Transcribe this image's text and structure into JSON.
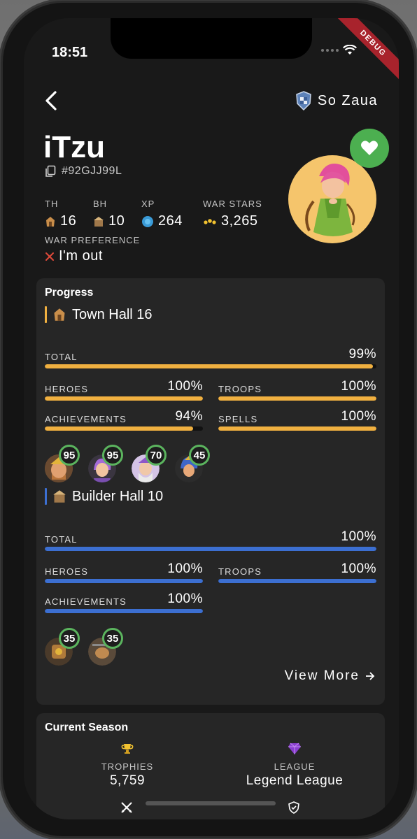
{
  "status": {
    "time": "18:51",
    "debug_label": "DEBUG"
  },
  "header": {
    "clan_name": "So Zaua"
  },
  "player": {
    "name": "iTzu",
    "tag": "#92GJJ99L",
    "stats": [
      {
        "label": "TH",
        "value": "16"
      },
      {
        "label": "BH",
        "value": "10"
      },
      {
        "label": "XP",
        "value": "264"
      },
      {
        "label": "WAR STARS",
        "value": "3,265"
      }
    ],
    "war_preference": {
      "label": "WAR PREFERENCE",
      "value": "I'm out"
    }
  },
  "progress": {
    "title": "Progress",
    "home": {
      "title": "Town Hall 16",
      "accent": "#f0b040",
      "total": {
        "label": "TOTAL",
        "pct": "99%",
        "value": 0.99
      },
      "items": [
        {
          "label": "HEROES",
          "pct": "100%",
          "value": 1.0
        },
        {
          "label": "TROOPS",
          "pct": "100%",
          "value": 1.0
        },
        {
          "label": "ACHIEVEMENTS",
          "pct": "94%",
          "value": 0.94
        },
        {
          "label": "SPELLS",
          "pct": "100%",
          "value": 1.0
        }
      ],
      "heroes": [
        "95",
        "95",
        "70",
        "45"
      ]
    },
    "builder": {
      "title": "Builder Hall 10",
      "accent": "#3c6fd1",
      "total": {
        "label": "TOTAL",
        "pct": "100%",
        "value": 1.0
      },
      "items": [
        {
          "label": "HEROES",
          "pct": "100%",
          "value": 1.0
        },
        {
          "label": "TROOPS",
          "pct": "100%",
          "value": 1.0
        },
        {
          "label": "ACHIEVEMENTS",
          "pct": "100%",
          "value": 1.0
        }
      ],
      "heroes": [
        "35",
        "35"
      ]
    },
    "view_more": "View More"
  },
  "season": {
    "title": "Current Season",
    "trophies": {
      "label": "TROPHIES",
      "value": "5,759"
    },
    "league": {
      "label": "LEAGUE",
      "value": "Legend League"
    }
  },
  "colors": {
    "fav": "#4caf50",
    "badge_ring": "#5bb45e",
    "war_x": "#e04a3a"
  }
}
